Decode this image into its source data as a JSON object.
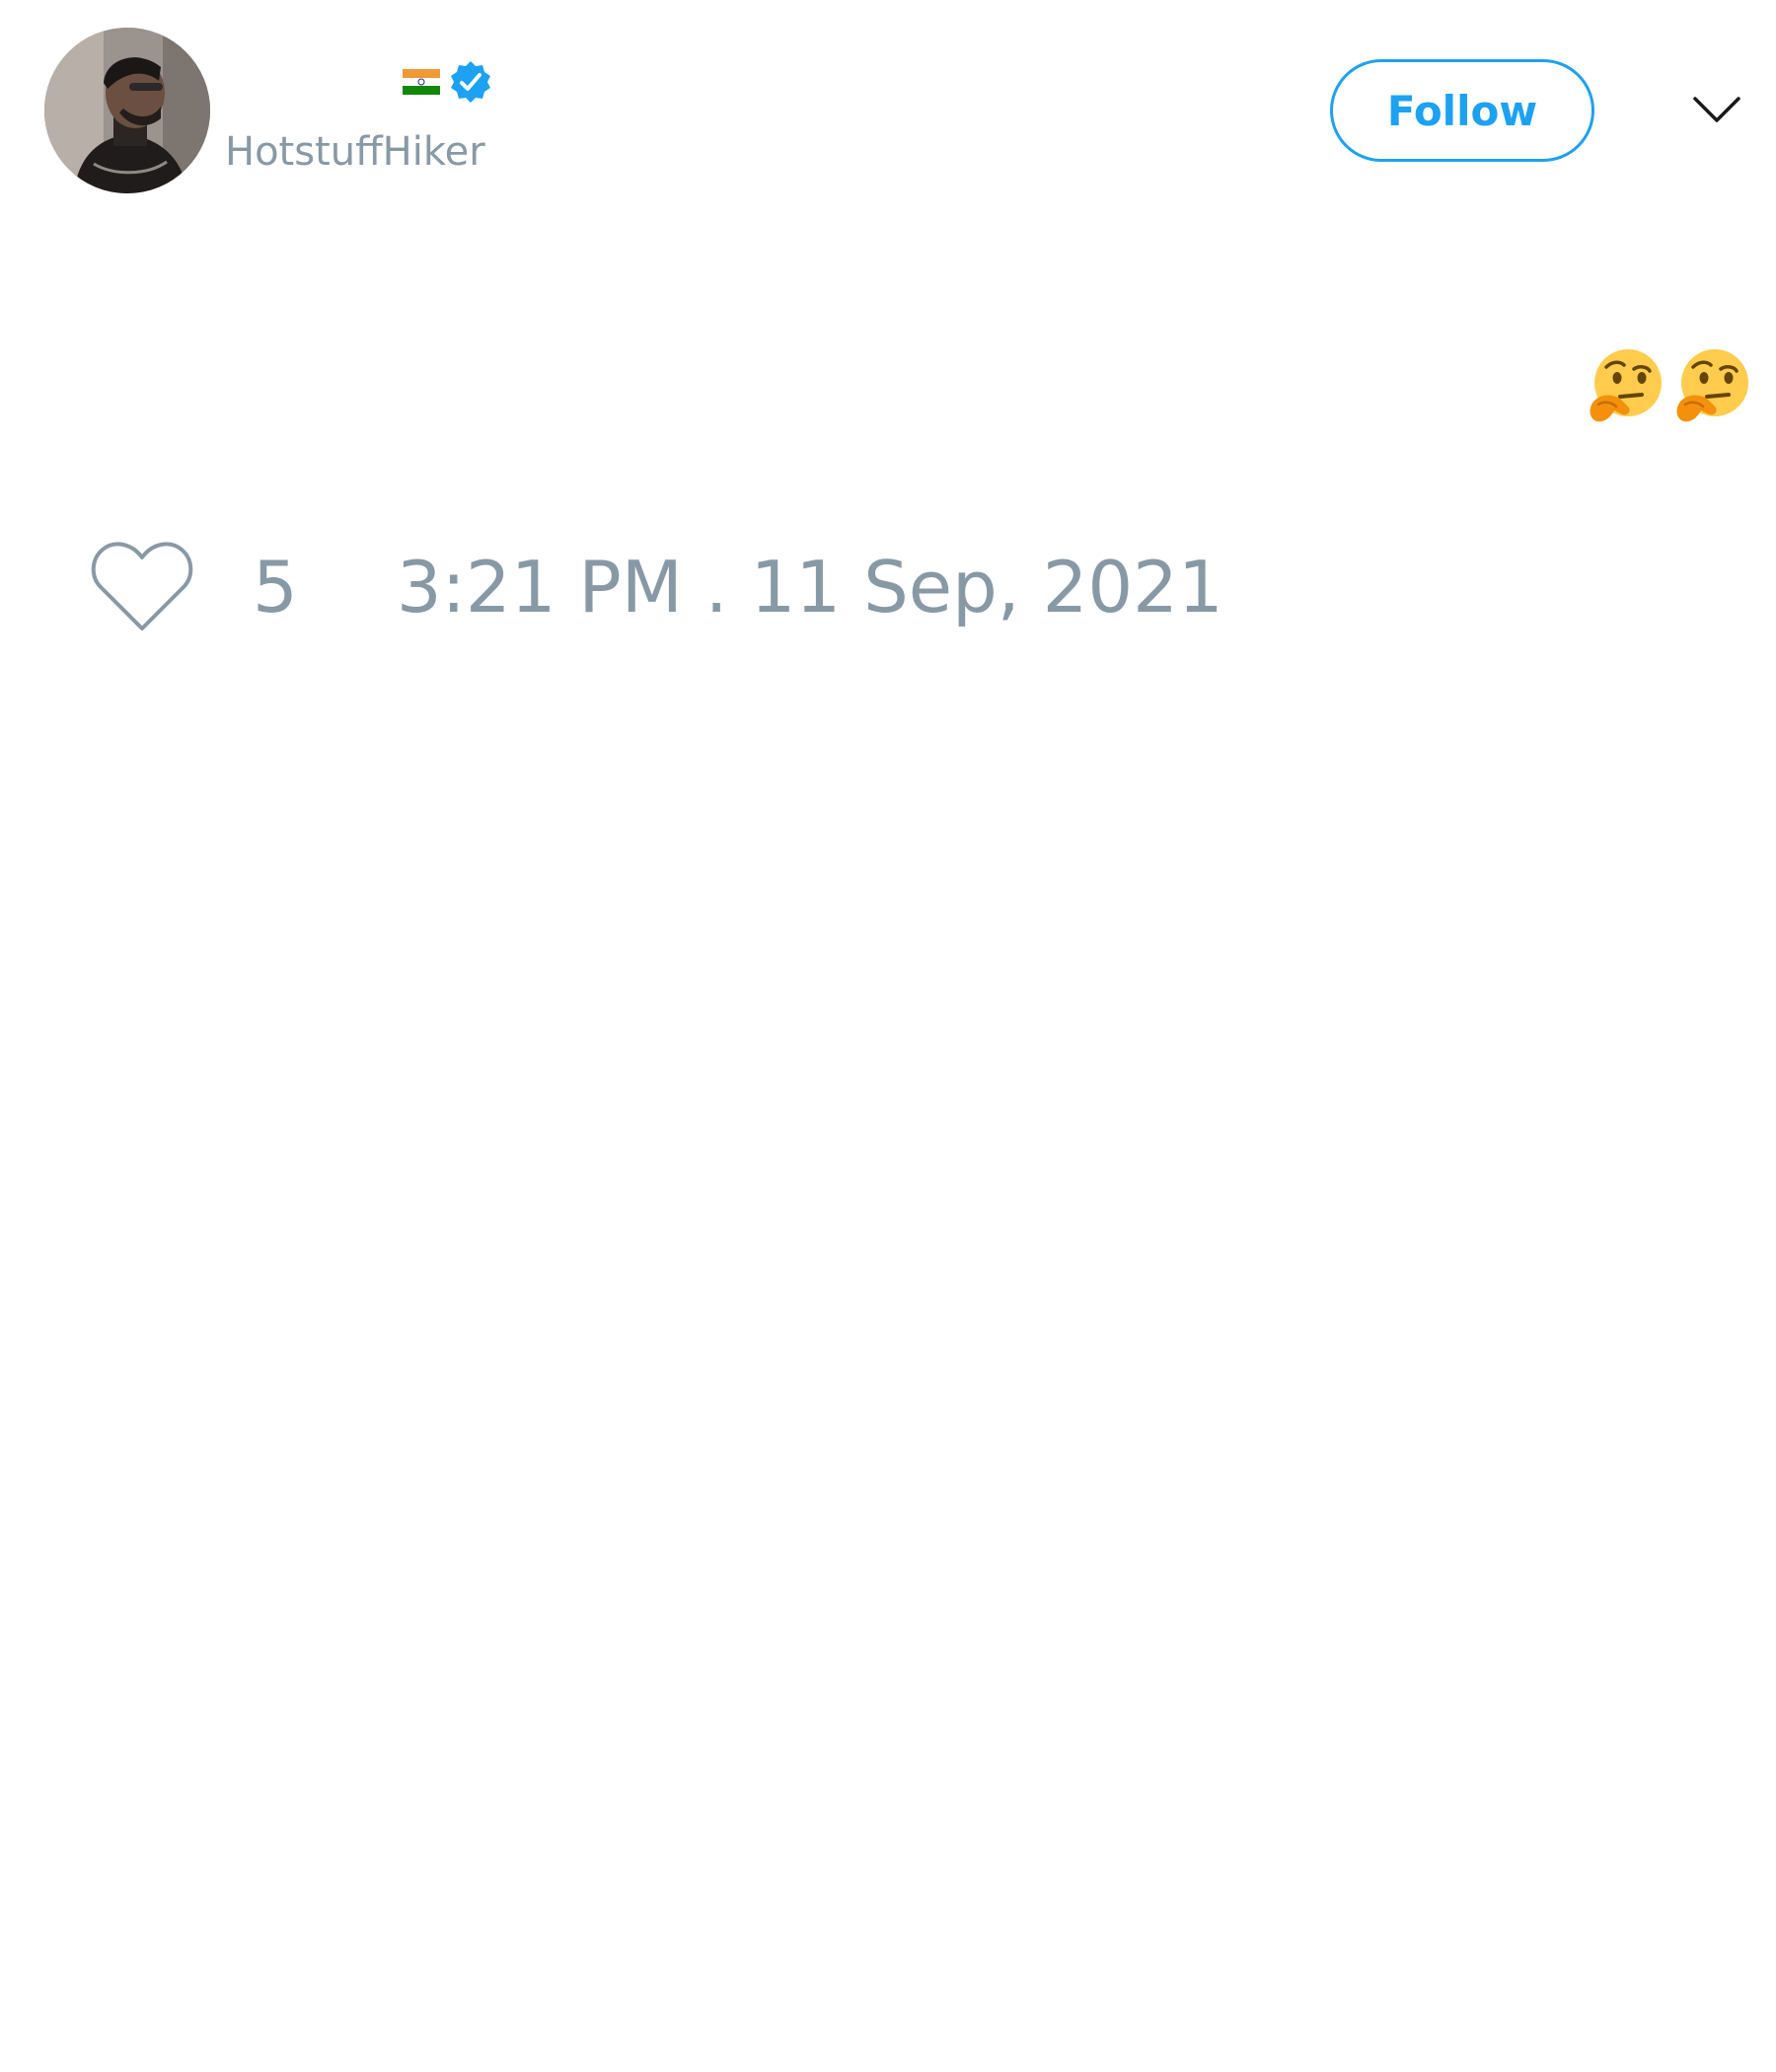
{
  "author": {
    "display_name": "",
    "flag_icon": "india-flag-icon",
    "verified_icon": "verified-badge-icon",
    "handle": "HotstuffHiker",
    "avatar": "profile-photo"
  },
  "actions": {
    "follow_label": "Follow",
    "menu_icon": "chevron-down-icon"
  },
  "tweet": {
    "text_emojis": [
      "thinking-face-emoji",
      "thinking-face-emoji"
    ]
  },
  "footer": {
    "like_icon": "heart-icon",
    "like_count": "5",
    "timestamp": "3:21 PM . 11 Sep, 2021"
  },
  "colors": {
    "accent": "#1da1f2",
    "muted_text": "#8899a6",
    "background": "#ffffff"
  }
}
